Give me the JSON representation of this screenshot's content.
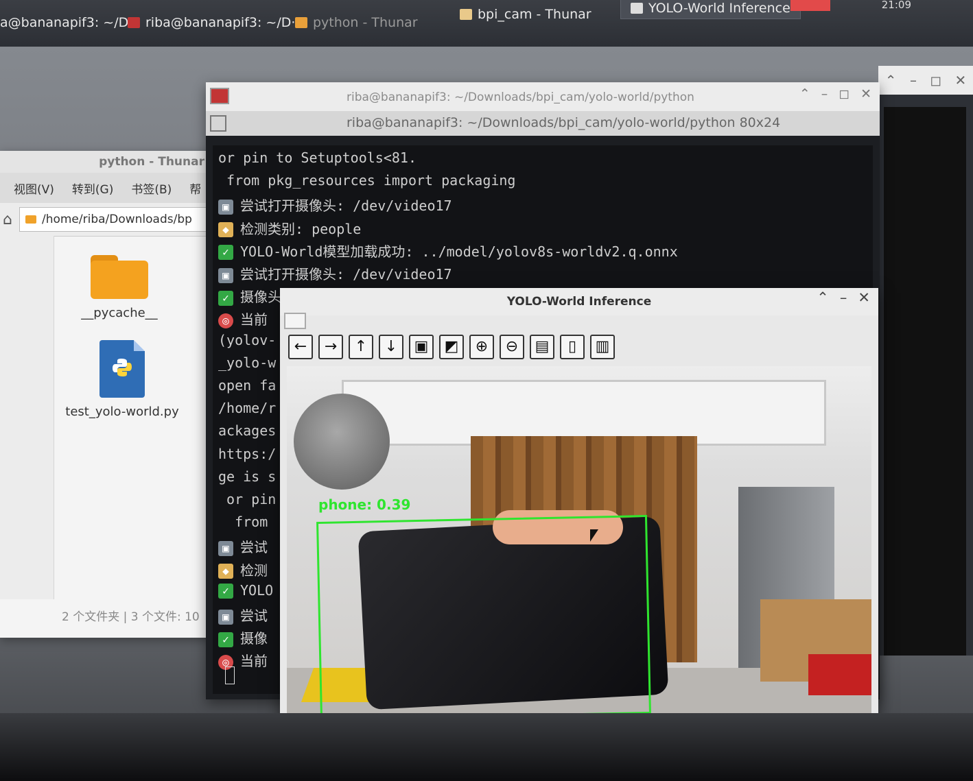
{
  "taskbar": {
    "tasks": [
      {
        "label": "a@bananapif3: ~/D···"
      },
      {
        "label": "riba@bananapif3: ~/D···"
      },
      {
        "label": "python - Thunar"
      },
      {
        "label": "bpi_cam - Thunar"
      },
      {
        "label": "YOLO-World Inference"
      }
    ],
    "clock": "21:09"
  },
  "thunar": {
    "title": "python - Thunar",
    "menu": [
      "视图(V)",
      "转到(G)",
      "书签(B)",
      "帮"
    ],
    "path": "/home/riba/Downloads/bp",
    "files": [
      {
        "name": "__pycache__",
        "icon": "folder-icon"
      },
      {
        "name": "test_yolo-world.py",
        "icon": "python-file-icon"
      }
    ],
    "status": "2 个文件夹 | 3 个文件: 10"
  },
  "terminal": {
    "title": "riba@bananapif3: ~/Downloads/bpi_cam/yolo-world/python",
    "tab_title": "riba@bananapif3: ~/Downloads/bpi_cam/yolo-world/python 80x24",
    "lines": [
      {
        "icon": "",
        "text": "or pin to Setuptools<81."
      },
      {
        "icon": "",
        "text": " from pkg_resources import packaging"
      },
      {
        "icon": "cam",
        "text": "尝试打开摄像头: /dev/video17"
      },
      {
        "icon": "tag",
        "text": "检测类别: people"
      },
      {
        "icon": "check",
        "text": "YOLO-World模型加载成功: ../model/yolov8s-worldv2.q.onnx"
      },
      {
        "icon": "cam",
        "text": "尝试打开摄像头: /dev/video17"
      },
      {
        "icon": "check",
        "text": "摄像头打开成功, 开始YOLO-World开放词汇检测..."
      },
      {
        "icon": "target",
        "text": "当前"
      },
      {
        "icon": "",
        "text": "(yolov-"
      },
      {
        "icon": "",
        "text": "_yolo-w"
      },
      {
        "icon": "",
        "text": "open fa"
      },
      {
        "icon": "",
        "text": "/home/r"
      },
      {
        "icon": "",
        "text": "ackages"
      },
      {
        "icon": "",
        "text": "https:/"
      },
      {
        "icon": "",
        "text": "ge is s"
      },
      {
        "icon": "",
        "text": " or pin"
      },
      {
        "icon": "",
        "text": "  from"
      },
      {
        "icon": "cam",
        "text": "尝试"
      },
      {
        "icon": "tag",
        "text": "检测"
      },
      {
        "icon": "check",
        "text": "YOLO"
      },
      {
        "icon": "cam",
        "text": "尝试"
      },
      {
        "icon": "check",
        "text": "摄像"
      },
      {
        "icon": "target",
        "text": "当前"
      }
    ]
  },
  "yolo_window": {
    "title": "YOLO-World Inference",
    "toolbar": [
      {
        "name": "back",
        "icon": "arrow-left-icon",
        "glyph": "←"
      },
      {
        "name": "forward",
        "icon": "arrow-right-icon",
        "glyph": "→"
      },
      {
        "name": "up",
        "icon": "arrow-up-icon",
        "glyph": "↑"
      },
      {
        "name": "down",
        "icon": "arrow-down-icon",
        "glyph": "↓"
      },
      {
        "name": "image",
        "icon": "image-icon",
        "glyph": "▣"
      },
      {
        "name": "image-person",
        "icon": "image-person-icon",
        "glyph": "◩"
      },
      {
        "name": "zoom-in",
        "icon": "zoom-in-icon",
        "glyph": "⊕"
      },
      {
        "name": "zoom-out",
        "icon": "zoom-out-icon",
        "glyph": "⊖"
      },
      {
        "name": "save",
        "icon": "save-icon",
        "glyph": "▤"
      },
      {
        "name": "clipboard",
        "icon": "clipboard-icon",
        "glyph": "▯"
      },
      {
        "name": "properties",
        "icon": "properties-icon",
        "glyph": "▥"
      }
    ],
    "detection": {
      "label": "phone: 0.39",
      "color": "#2fe52f"
    }
  },
  "colors": {
    "accent_green": "#2fe52f",
    "terminal_bg": "#121316",
    "folder": "#f4a21f",
    "python_file": "#2f6db5"
  }
}
